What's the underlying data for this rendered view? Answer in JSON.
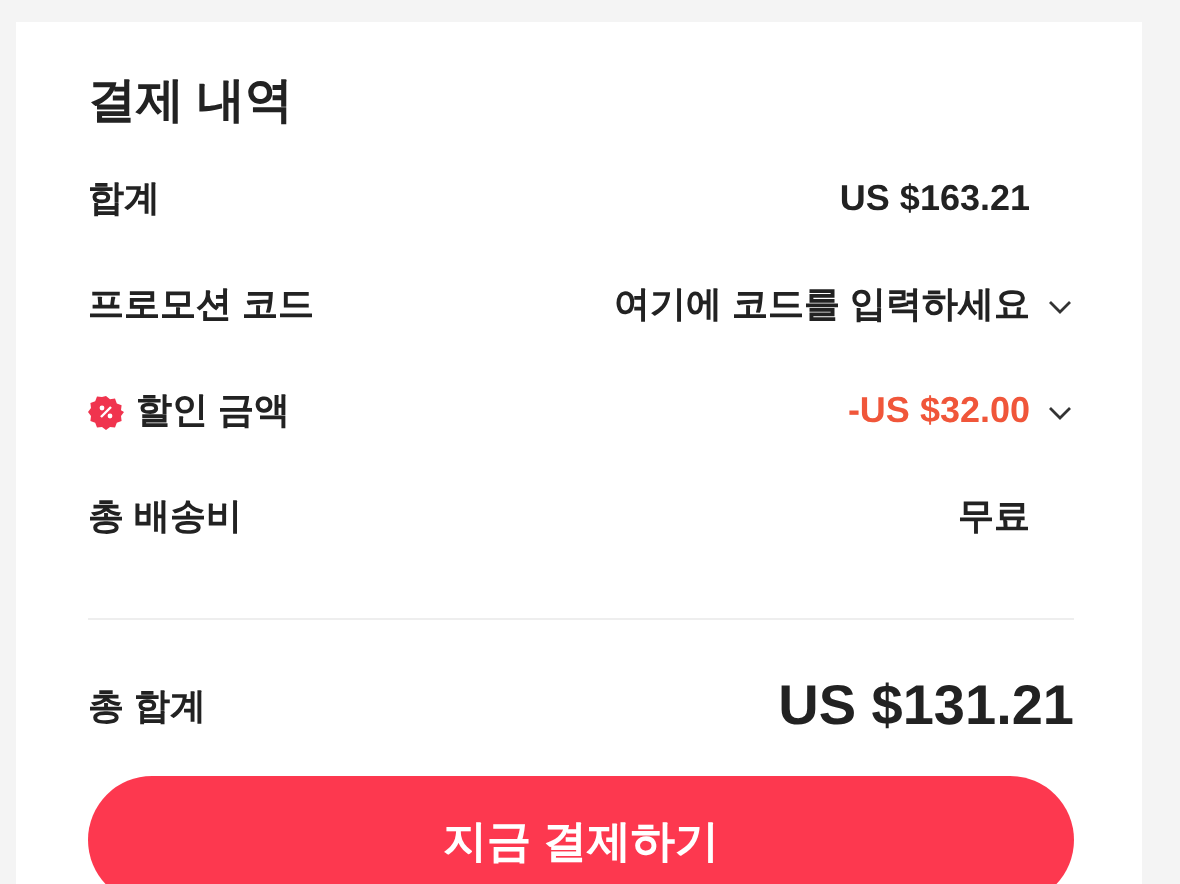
{
  "title": "결제 내역",
  "rows": [
    {
      "kind": "plain",
      "label": "합계",
      "value": "US $163.21"
    },
    {
      "kind": "dropdown",
      "label": "프로모션 코드",
      "value": "여기에 코드를 입력하세요"
    },
    {
      "kind": "discount",
      "label": "할인 금액",
      "value": "-US $32.00"
    },
    {
      "kind": "plain",
      "label": "총 배송비",
      "value": "무료"
    }
  ],
  "total": {
    "label": "총 합계",
    "value": "US $131.21"
  },
  "button": "지금 결제하기"
}
